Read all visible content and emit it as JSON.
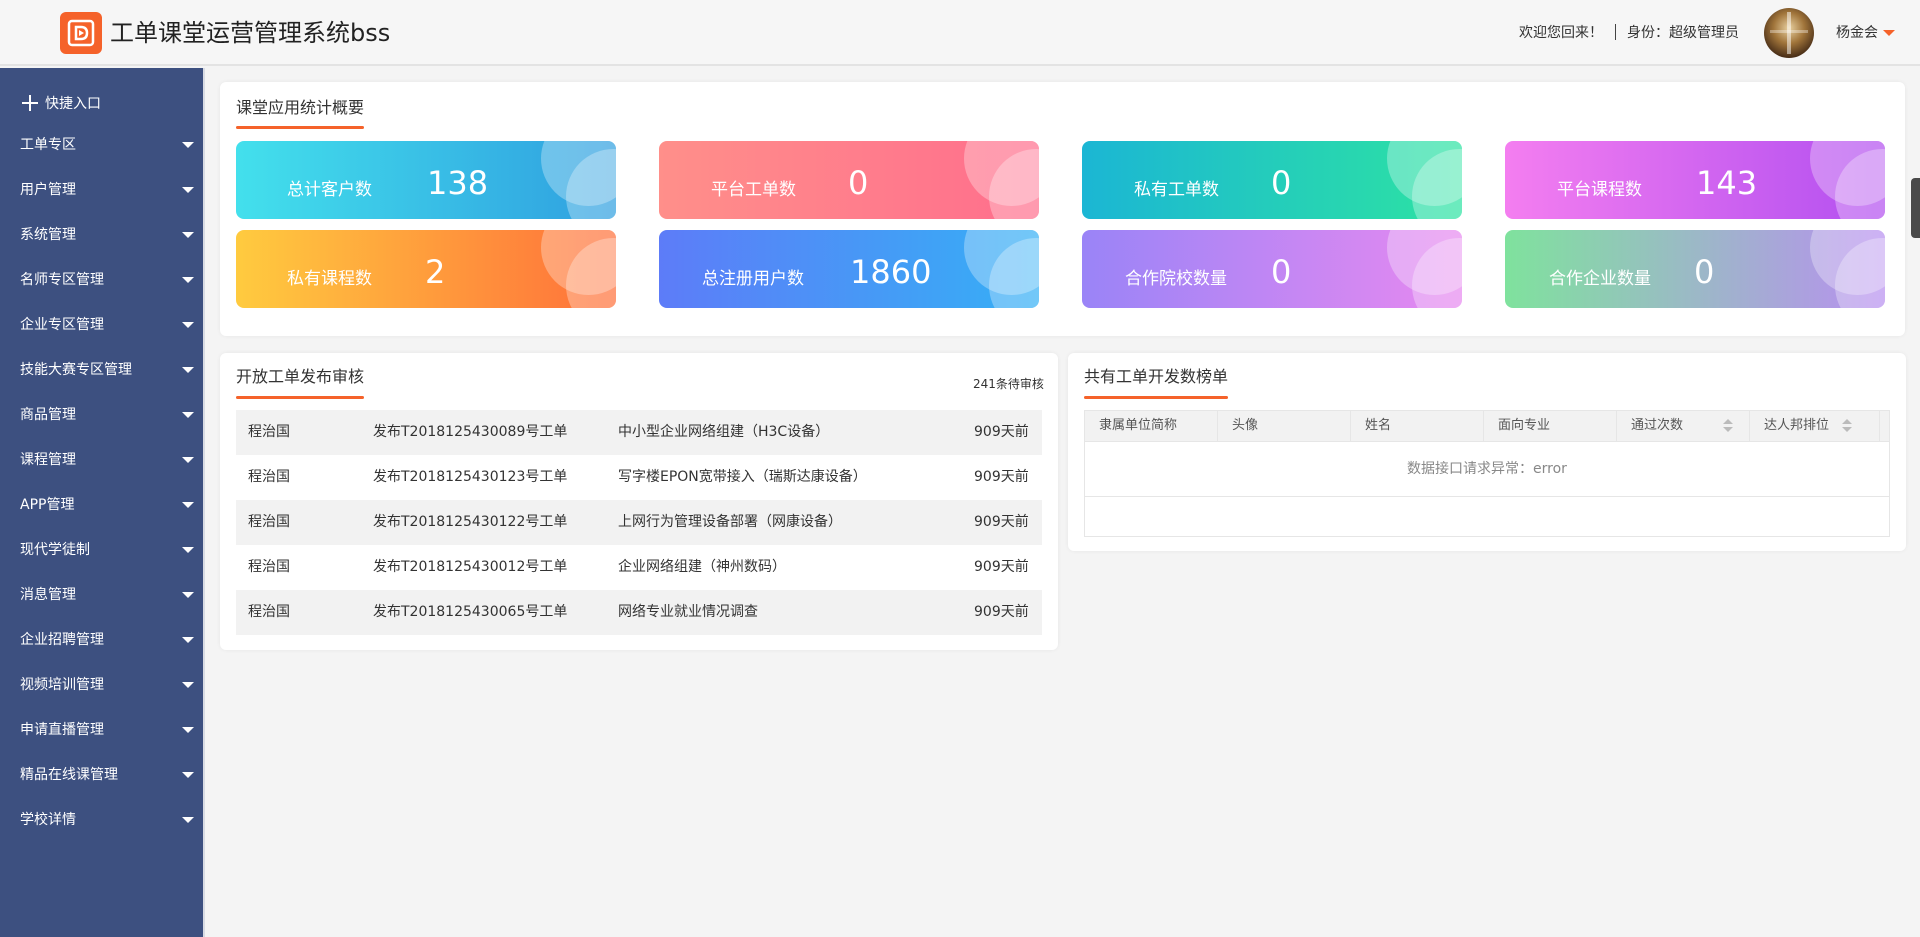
{
  "header": {
    "app_title": "工单课堂运营管理系统bss",
    "welcome": "欢迎您回来！",
    "role": "身份：超级管理员",
    "username": "杨金会"
  },
  "sidebar": {
    "quick_entry": "快捷入口",
    "items": [
      {
        "label": "工单专区"
      },
      {
        "label": "用户管理"
      },
      {
        "label": "系统管理"
      },
      {
        "label": "名师专区管理"
      },
      {
        "label": "企业专区管理"
      },
      {
        "label": "技能大赛专区管理"
      },
      {
        "label": "商品管理"
      },
      {
        "label": "课程管理"
      },
      {
        "label": "APP管理"
      },
      {
        "label": "现代学徒制"
      },
      {
        "label": "消息管理"
      },
      {
        "label": "企业招聘管理"
      },
      {
        "label": "视频培训管理"
      },
      {
        "label": "申请直播管理"
      },
      {
        "label": "精品在线课管理"
      },
      {
        "label": "学校详情"
      }
    ]
  },
  "stats": {
    "title": "课堂应用统计概要",
    "cards": [
      {
        "label": "总计客户数",
        "value": "138",
        "color_from": "#43e0ec",
        "color_to": "#2f9fe0"
      },
      {
        "label": "平台工单数",
        "value": "0",
        "color_from": "#ff8f8a",
        "color_to": "#ff6e8d"
      },
      {
        "label": "私有工单数",
        "value": "0",
        "color_from": "#1bb6d4",
        "color_to": "#2de3a2"
      },
      {
        "label": "平台课程数",
        "value": "143",
        "color_from": "#f47ef0",
        "color_to": "#b24ff0"
      },
      {
        "label": "私有课程数",
        "value": "2",
        "color_from": "#ffcb3f",
        "color_to": "#ff6f3a"
      },
      {
        "label": "总注册用户数",
        "value": "1860",
        "color_from": "#5d7cf8",
        "color_to": "#35b0f5"
      },
      {
        "label": "合作院校数量",
        "value": "0",
        "color_from": "#9a84f7",
        "color_to": "#e789f0"
      },
      {
        "label": "合作企业数量",
        "value": "0",
        "color_from": "#7fe29d",
        "color_to": "#b88ff0"
      }
    ]
  },
  "review": {
    "title": "开放工单发布审核",
    "pending": "241条待审核",
    "rows": [
      {
        "name": "程治国",
        "code": "发布T2018125430089号工单",
        "title": "中小型企业网络组建（H3C设备）",
        "time": "909天前"
      },
      {
        "name": "程治国",
        "code": "发布T2018125430123号工单",
        "title": "写字楼EPON宽带接入（瑞斯达康设备）",
        "time": "909天前"
      },
      {
        "name": "程治国",
        "code": "发布T2018125430122号工单",
        "title": "上网行为管理设备部署（网康设备）",
        "time": "909天前"
      },
      {
        "name": "程治国",
        "code": "发布T2018125430012号工单",
        "title": "企业网络组建（神州数码）",
        "time": "909天前"
      },
      {
        "name": "程治国",
        "code": "发布T2018125430065号工单",
        "title": "网络专业就业情况调查",
        "time": "909天前"
      }
    ]
  },
  "leaderboard": {
    "title": "共有工单开发数榜单",
    "columns": [
      {
        "label": "隶属单位简称",
        "sortable": false
      },
      {
        "label": "头像",
        "sortable": false
      },
      {
        "label": "姓名",
        "sortable": false
      },
      {
        "label": "面向专业",
        "sortable": false
      },
      {
        "label": "通过次数",
        "sortable": true
      },
      {
        "label": "达人邦排位",
        "sortable": true
      }
    ],
    "error": "数据接口请求异常：error"
  }
}
